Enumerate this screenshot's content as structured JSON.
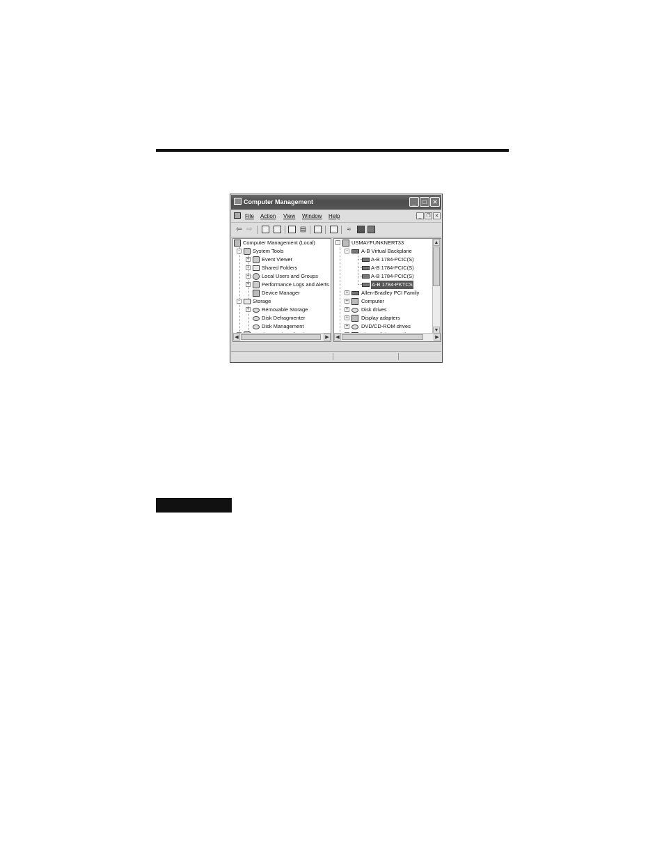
{
  "window": {
    "title": "Computer Management",
    "controls": [
      "minimize",
      "maximize",
      "close"
    ]
  },
  "menu": {
    "items": [
      "File",
      "Action",
      "View",
      "Window",
      "Help"
    ]
  },
  "toolbar": {
    "icons": [
      "back-arrow-icon",
      "forward-arrow-icon",
      "up-folder-icon",
      "show-hide-tree-icon",
      "properties-icon",
      "print-icon",
      "help-icon",
      "computer-icon",
      "scan-hardware-icon",
      "uninstall-icon",
      "disable-icon"
    ]
  },
  "left_tree": {
    "root": "Computer Management (Local)",
    "items": [
      {
        "label": "System Tools",
        "level": 1,
        "expander": "-"
      },
      {
        "label": "Event Viewer",
        "level": 2,
        "expander": "+"
      },
      {
        "label": "Shared Folders",
        "level": 2,
        "expander": "+"
      },
      {
        "label": "Local Users and Groups",
        "level": 2,
        "expander": "+"
      },
      {
        "label": "Performance Logs and Alerts",
        "level": 2,
        "expander": "+"
      },
      {
        "label": "Device Manager",
        "level": 2,
        "expander": ""
      },
      {
        "label": "Storage",
        "level": 1,
        "expander": "-"
      },
      {
        "label": "Removable Storage",
        "level": 2,
        "expander": "+"
      },
      {
        "label": "Disk Defragmenter",
        "level": 2,
        "expander": ""
      },
      {
        "label": "Disk Management",
        "level": 2,
        "expander": ""
      },
      {
        "label": "Services and Applications",
        "level": 1,
        "expander": "+"
      }
    ]
  },
  "right_tree": {
    "root": "USMAYFUNKNERT33",
    "items": [
      {
        "label": "A-B Virtual Backplane",
        "level": 1,
        "expander": "-"
      },
      {
        "label": "A-B 1784-PCIC(S)",
        "level": 2,
        "expander": ""
      },
      {
        "label": "A-B 1784-PCIC(S)",
        "level": 2,
        "expander": ""
      },
      {
        "label": "A-B 1784-PCIC(S)",
        "level": 2,
        "expander": ""
      },
      {
        "label": "A-B 1784-PKTCS",
        "level": 2,
        "expander": "",
        "selected": true
      },
      {
        "label": "Allen-Bradley PCI Family",
        "level": 1,
        "expander": "+"
      },
      {
        "label": "Computer",
        "level": 1,
        "expander": "+"
      },
      {
        "label": "Disk drives",
        "level": 1,
        "expander": "+"
      },
      {
        "label": "Display adapters",
        "level": 1,
        "expander": "+"
      },
      {
        "label": "DVD/CD-ROM drives",
        "level": 1,
        "expander": "+"
      },
      {
        "label": "Floppy disk controllers",
        "level": 1,
        "expander": "+"
      }
    ]
  }
}
